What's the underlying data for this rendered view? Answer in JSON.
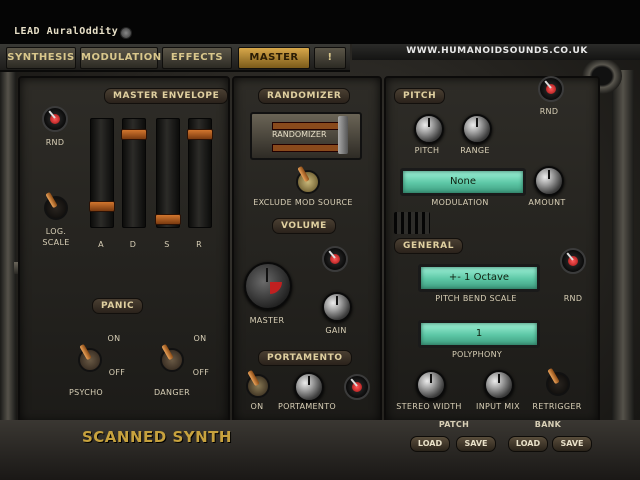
{
  "window": {
    "preset_name": "LEAD AuralOddity"
  },
  "tabs": [
    {
      "label": "SYNTHESIS",
      "active": false
    },
    {
      "label": "MODULATION",
      "active": false
    },
    {
      "label": "EFFECTS",
      "active": false
    },
    {
      "label": "MASTER",
      "active": true
    },
    {
      "label": "!",
      "active": false
    }
  ],
  "website": "WWW.HUMANOIDSOUNDS.CO.UK",
  "master_envelope": {
    "title": "MASTER ENVELOPE",
    "rnd_label": "RND",
    "log_scale_label": "LOG. SCALE",
    "sliders": [
      {
        "label": "A",
        "value": 0.15
      },
      {
        "label": "D",
        "value": 0.9
      },
      {
        "label": "S",
        "value": 0.02
      },
      {
        "label": "R",
        "value": 0.9
      }
    ]
  },
  "panic": {
    "title": "PANIC",
    "on_label": "ON",
    "off_label": "OFF",
    "psycho_label": "PSYCHO",
    "danger_label": "DANGER"
  },
  "randomizer": {
    "title": "RANDOMIZER",
    "button_label": "RANDOMIZER",
    "exclude_label": "EXCLUDE MOD SOURCE"
  },
  "volume": {
    "title": "VOLUME",
    "master_label": "MASTER",
    "gain_label": "GAIN"
  },
  "portamento": {
    "title": "PORTAMENTO",
    "on_label": "ON",
    "knob_label": "PORTAMENTO"
  },
  "pitch": {
    "title": "PITCH",
    "rnd_label": "RND",
    "pitch_label": "PITCH",
    "range_label": "RANGE",
    "modulation_value": "None",
    "modulation_label": "MODULATION",
    "amount_label": "AMOUNT"
  },
  "general": {
    "title": "GENERAL",
    "pitch_bend_value": "+- 1 Octave",
    "pitch_bend_label": "PITCH BEND SCALE",
    "rnd_label": "RND",
    "polyphony_value": "1",
    "polyphony_label": "POLYPHONY",
    "stereo_width_label": "STEREO WIDTH",
    "input_mix_label": "INPUT MIX",
    "retrigger_label": "RETRIGGER"
  },
  "footer": {
    "brand": "SCANNED SYNTH",
    "patch_label": "PATCH",
    "bank_label": "BANK",
    "load_label": "LOAD",
    "save_label": "SAVE"
  }
}
